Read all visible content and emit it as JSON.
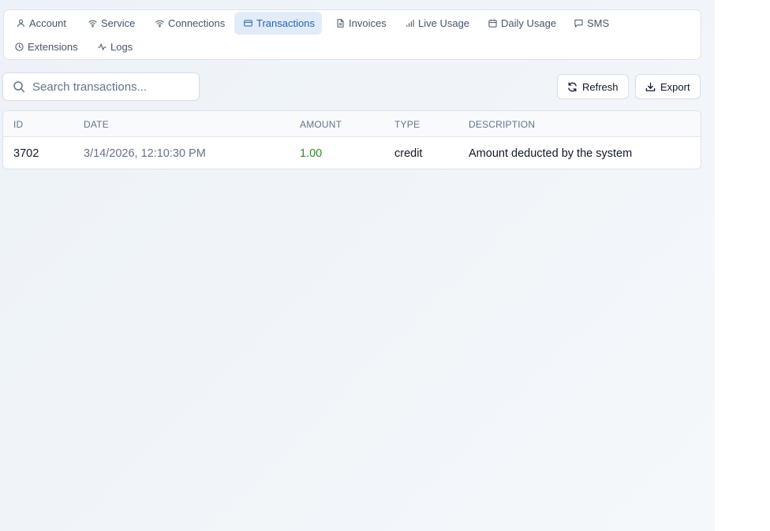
{
  "tabs": [
    {
      "label": "Account",
      "icon": "user-icon",
      "active": false
    },
    {
      "label": "Service",
      "icon": "wifi-icon",
      "active": false
    },
    {
      "label": "Connections",
      "icon": "wifi-icon",
      "active": false
    },
    {
      "label": "Transactions",
      "icon": "credit-card-icon",
      "active": true
    },
    {
      "label": "Invoices",
      "icon": "file-text-icon",
      "active": false
    },
    {
      "label": "Live Usage",
      "icon": "signal-bars-icon",
      "active": false
    },
    {
      "label": "Daily Usage",
      "icon": "calendar-icon",
      "active": false
    },
    {
      "label": "SMS",
      "icon": "message-icon",
      "active": false
    },
    {
      "label": "Extensions",
      "icon": "clock-icon",
      "active": false
    },
    {
      "label": "Logs",
      "icon": "activity-icon",
      "active": false
    }
  ],
  "search": {
    "placeholder": "Search transactions...",
    "value": ""
  },
  "toolbar": {
    "refresh_label": "Refresh",
    "export_label": "Export"
  },
  "table": {
    "columns": [
      "ID",
      "DATE",
      "AMOUNT",
      "TYPE",
      "DESCRIPTION"
    ],
    "rows": [
      {
        "id": "3702",
        "date": "3/14/2026, 12:10:30 PM",
        "amount": "1.00",
        "type": "credit",
        "description": "Amount deducted by the system"
      }
    ]
  },
  "colors": {
    "accent": "#2563b0",
    "active_tab_bg": "#e2ebf8",
    "amount_positive": "#2f8a2c"
  }
}
